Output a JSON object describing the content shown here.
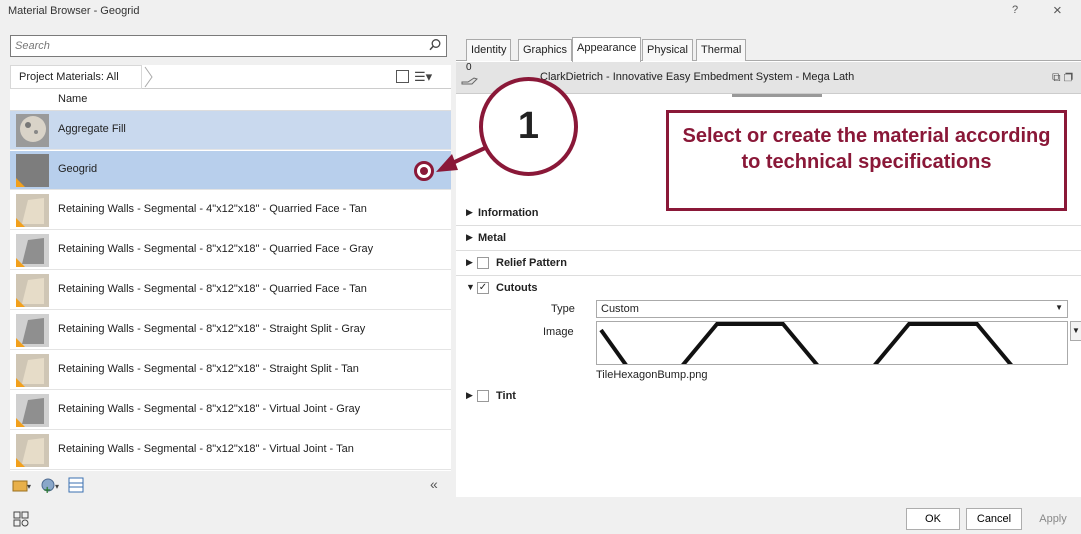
{
  "window": {
    "title": "Material Browser - Geogrid",
    "help": "?",
    "close": "×"
  },
  "search": {
    "placeholder": "Search"
  },
  "filter": {
    "label": "Project Materials: All"
  },
  "list": {
    "column": "Name",
    "items": [
      {
        "label": "Aggregate Fill"
      },
      {
        "label": "Geogrid"
      },
      {
        "label": "Retaining Walls - Segmental - 4\"x12\"x18\" - Quarried Face - Tan"
      },
      {
        "label": "Retaining Walls - Segmental - 8\"x12\"x18\" -  Quarried Face - Gray"
      },
      {
        "label": "Retaining Walls - Segmental - 8\"x12\"x18\" - Quarried Face - Tan"
      },
      {
        "label": "Retaining Walls - Segmental - 8\"x12\"x18\" - Straight Split - Gray"
      },
      {
        "label": "Retaining Walls - Segmental - 8\"x12\"x18\" - Straight Split - Tan"
      },
      {
        "label": "Retaining Walls - Segmental - 8\"x12\"x18\" - Virtual Joint - Gray"
      },
      {
        "label": "Retaining Walls - Segmental - 8\"x12\"x18\" - Virtual Joint - Tan"
      }
    ]
  },
  "tabs": [
    "Identity",
    "Graphics",
    "Appearance",
    "Physical",
    "Thermal"
  ],
  "asset": {
    "count": "0",
    "name": "ClarkDietrich - Innovative Easy Embedment System - Mega Lath"
  },
  "sections": {
    "information": "Information",
    "metal": "Metal",
    "relief": "Relief Pattern",
    "cutouts": "Cutouts",
    "tint": "Tint"
  },
  "cutouts": {
    "type_label": "Type",
    "type_value": "Custom",
    "image_label": "Image",
    "image_file": "TileHexagonBump.png"
  },
  "buttons": {
    "ok": "OK",
    "cancel": "Cancel",
    "apply": "Apply"
  },
  "annotation": {
    "number": "1",
    "text": "Select or create the material according to technical specifications",
    "color": "#8a1838"
  },
  "colors": {
    "selection": "#c9d9ee",
    "accent": "#8a1838"
  }
}
